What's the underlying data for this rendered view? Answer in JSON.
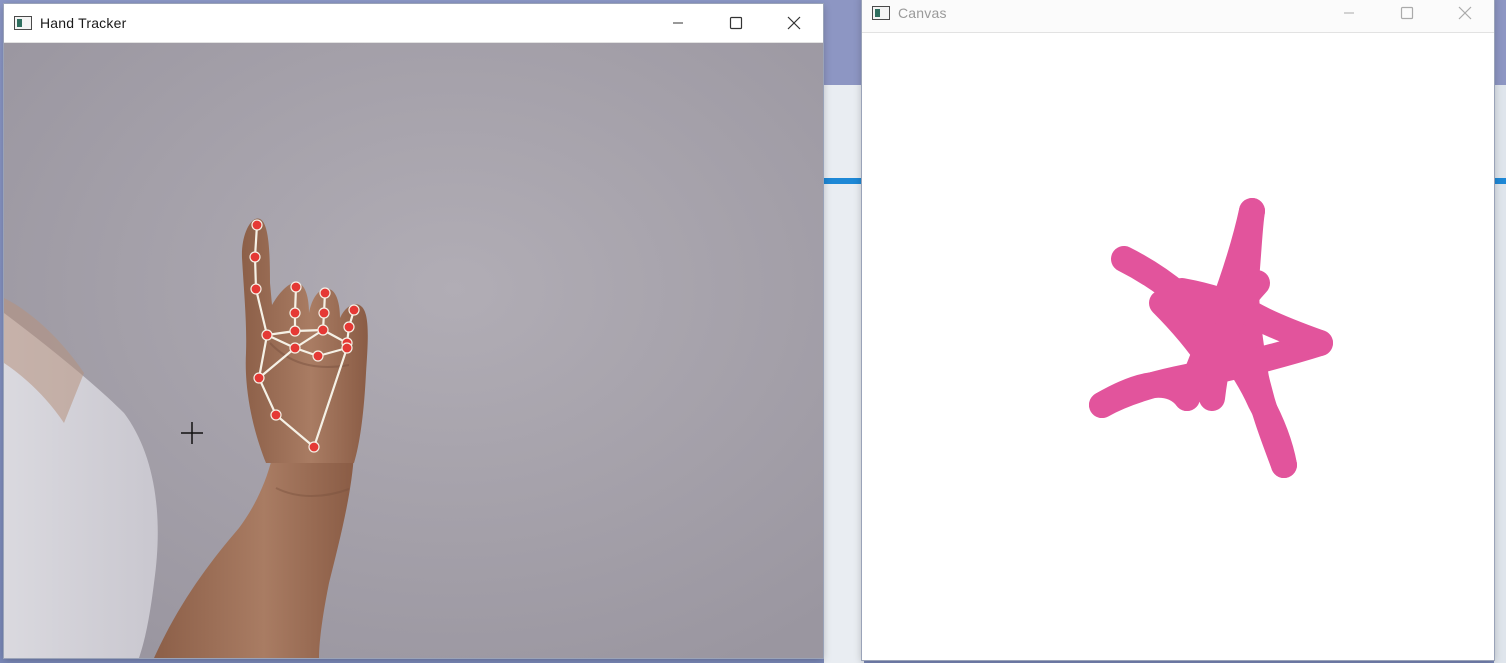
{
  "hand_window": {
    "title": "Hand Tracker",
    "controls": {
      "minimize_icon": "minimize-icon",
      "maximize_icon": "maximize-icon",
      "close_icon": "close-icon"
    }
  },
  "canvas_window": {
    "title": "Canvas"
  },
  "colors": {
    "landmark": "#e53935",
    "connection": "#f5f1e6",
    "stroke": "#e2549c",
    "skin": "#a0725a"
  }
}
